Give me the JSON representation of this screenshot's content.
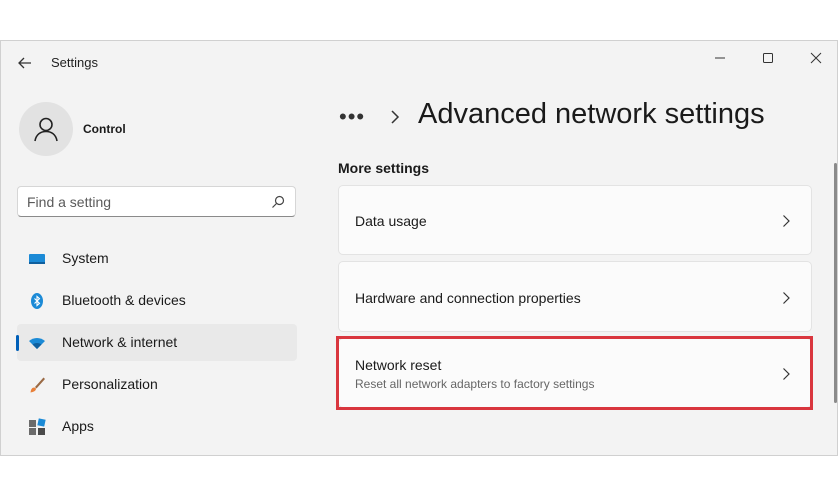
{
  "window": {
    "title": "Settings"
  },
  "profile": {
    "name": "Control"
  },
  "search": {
    "placeholder": "Find a setting"
  },
  "sidebar": {
    "items": [
      {
        "label": "System",
        "icon": "system-icon",
        "active": false
      },
      {
        "label": "Bluetooth & devices",
        "icon": "bluetooth-icon",
        "active": false
      },
      {
        "label": "Network & internet",
        "icon": "wifi-icon",
        "active": true
      },
      {
        "label": "Personalization",
        "icon": "brush-icon",
        "active": false
      },
      {
        "label": "Apps",
        "icon": "apps-icon",
        "active": false
      }
    ]
  },
  "main": {
    "breadcrumb_more": "•••",
    "page_title": "Advanced network settings",
    "section_title": "More settings",
    "cards": [
      {
        "title": "Data usage",
        "subtitle": ""
      },
      {
        "title": "Hardware and connection properties",
        "subtitle": ""
      },
      {
        "title": "Network reset",
        "subtitle": "Reset all network adapters to factory settings"
      }
    ]
  },
  "colors": {
    "accent": "#005fb8",
    "highlight": "#d9363e",
    "window_bg": "#f3f3f3",
    "card_bg": "#fbfbfb"
  }
}
